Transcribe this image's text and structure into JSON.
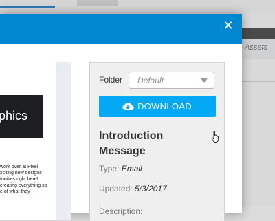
{
  "background": {
    "panel_label": "Assets"
  },
  "modal": {
    "close_icon": "close-icon",
    "preview": {
      "hero_text": "phics",
      "body_lines": [
        "work over at Pixel",
        "xciting new designs",
        "tunities right here!",
        "creating everything so",
        "e of what they"
      ]
    },
    "folder": {
      "label": "Folder",
      "selected": "Default"
    },
    "download_label": "DOWNLOAD",
    "asset": {
      "title": "Introduction Message",
      "type_label": "Type:",
      "type_value": "Email",
      "updated_label": "Updated:",
      "updated_value": "5/3/2017",
      "description_label": "Description:"
    }
  },
  "colors": {
    "header": "#0288d1",
    "button": "#03a9f4"
  }
}
